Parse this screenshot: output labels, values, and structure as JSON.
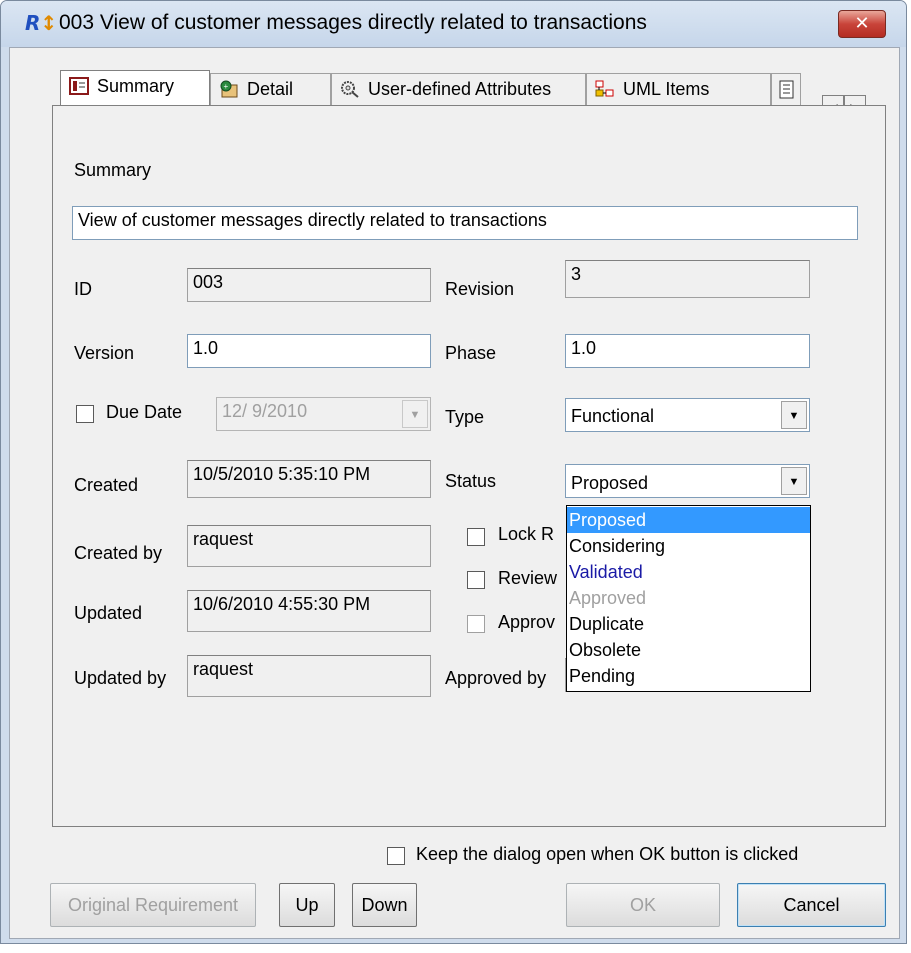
{
  "window": {
    "title": "003 View of customer messages directly related to transactions",
    "close_label": "✕"
  },
  "tabs": [
    {
      "label": "Summary",
      "icon": "summary-icon"
    },
    {
      "label": "Detail",
      "icon": "detail-icon"
    },
    {
      "label": "User-defined Attributes",
      "icon": "attributes-icon"
    },
    {
      "label": "UML Items",
      "icon": "uml-icon"
    }
  ],
  "summary": {
    "section_label": "Summary",
    "summary_value": "View of customer messages directly related to transactions",
    "id_label": "ID",
    "id_value": "003",
    "revision_label": "Revision",
    "revision_value": "3",
    "version_label": "Version",
    "version_value": "1.0",
    "phase_label": "Phase",
    "phase_value": "1.0",
    "due_date_label": "Due Date",
    "due_date_value": "12/ 9/2010",
    "type_label": "Type",
    "type_value": "Functional",
    "created_label": "Created",
    "created_value": "10/5/2010 5:35:10 PM",
    "status_label": "Status",
    "status_value": "Proposed",
    "created_by_label": "Created by",
    "created_by_value": "raquest",
    "lock_label": "Lock R",
    "review_label": "Review",
    "approve_label": "Approv",
    "updated_label": "Updated",
    "updated_value": "10/6/2010 4:55:30 PM",
    "updated_by_label": "Updated by",
    "updated_by_value": "raquest",
    "approved_by_label": "Approved by"
  },
  "status_options": [
    {
      "label": "Proposed",
      "state": "selected"
    },
    {
      "label": "Considering",
      "state": "normal"
    },
    {
      "label": "Validated",
      "state": "blue"
    },
    {
      "label": "Approved",
      "state": "disabled"
    },
    {
      "label": "Duplicate",
      "state": "normal"
    },
    {
      "label": "Obsolete",
      "state": "normal"
    },
    {
      "label": "Pending",
      "state": "normal"
    }
  ],
  "footer": {
    "keep_open_label": "Keep the dialog open when OK button is clicked",
    "original_label": "Original Requirement",
    "up_label": "Up",
    "down_label": "Down",
    "ok_label": "OK",
    "cancel_label": "Cancel"
  },
  "colors": {
    "selection": "#3399ff",
    "validated_text": "#1a1aa6",
    "disabled_text": "#a0a0a0"
  }
}
